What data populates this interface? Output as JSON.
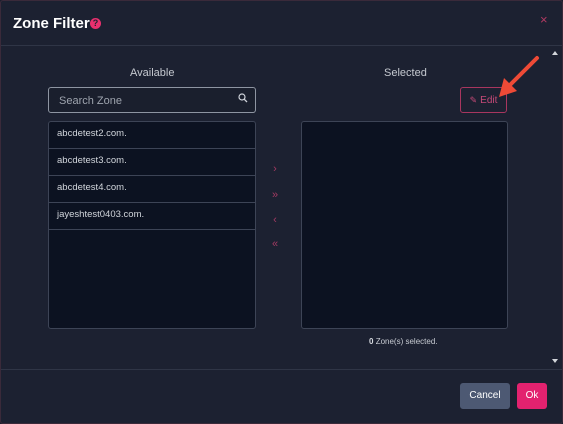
{
  "dialog": {
    "title": "Zone Filter",
    "help_icon": "?",
    "close_icon": "×"
  },
  "available": {
    "title": "Available",
    "search_placeholder": "Search Zone",
    "items": [
      "abcdetest2.com.",
      "abcdetest3.com.",
      "abcdetest4.com.",
      "jayeshtest0403.com."
    ]
  },
  "transfer": {
    "move_right": "›",
    "move_all_right": "»",
    "move_left": "‹",
    "move_all_left": "«"
  },
  "selected": {
    "title": "Selected",
    "edit_label": "Edit",
    "count": "0",
    "count_suffix": "Zone(s) selected.",
    "items": []
  },
  "footer": {
    "cancel_label": "Cancel",
    "ok_label": "Ok"
  },
  "colors": {
    "accent": "#e3226f",
    "annotation_arrow": "#ee4a36"
  }
}
